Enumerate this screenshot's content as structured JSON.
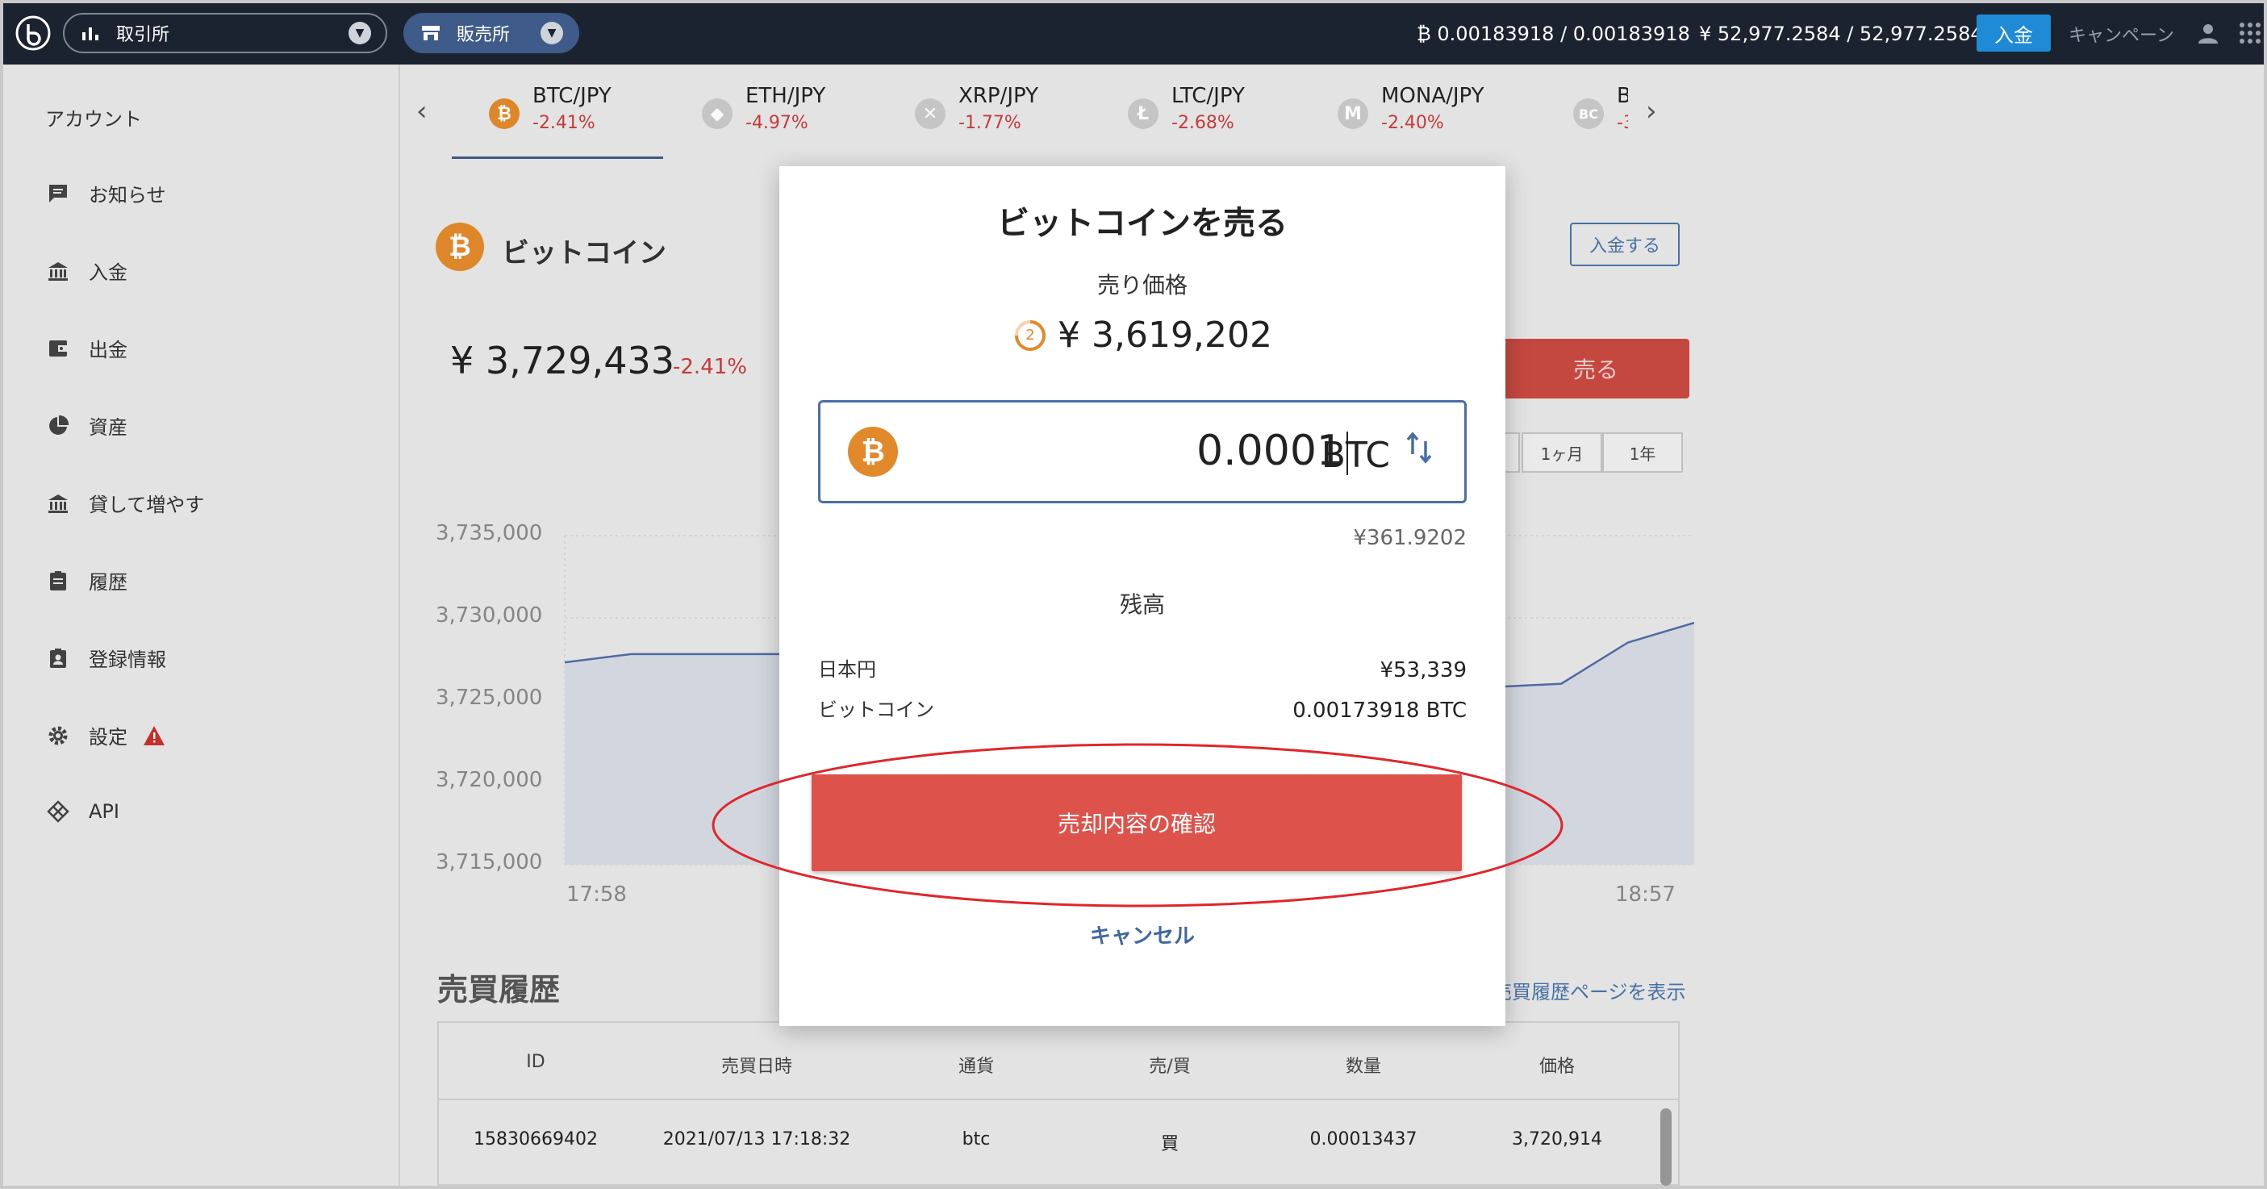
{
  "header": {
    "exchange_select": "取引所",
    "store_select": "販売所",
    "btc_balance": "₿ 0.00183918 / 0.00183918",
    "jpy_balance": "¥ 52,977.2584 / 52,977.2584",
    "deposit_label": "入金",
    "campaign_label": "キャンペーン"
  },
  "sidebar": {
    "title": "アカウント",
    "items": [
      {
        "label": "お知らせ",
        "icon": "message-icon"
      },
      {
        "label": "入金",
        "icon": "bank-icon"
      },
      {
        "label": "出金",
        "icon": "wallet-icon"
      },
      {
        "label": "資産",
        "icon": "pie-chart-icon"
      },
      {
        "label": "貸して増やす",
        "icon": "bank-icon"
      },
      {
        "label": "履歴",
        "icon": "clipboard-icon"
      },
      {
        "label": "登録情報",
        "icon": "id-badge-icon"
      },
      {
        "label": "設定",
        "icon": "gear-icon"
      },
      {
        "label": "API",
        "icon": "api-icon"
      }
    ],
    "warning_icon": "warning-icon"
  },
  "tabs": [
    {
      "name": "BTC/JPY",
      "change": "-2.41%",
      "symbol": "₿"
    },
    {
      "name": "ETH/JPY",
      "change": "-4.97%",
      "symbol": "◆"
    },
    {
      "name": "XRP/JPY",
      "change": "-1.77%",
      "symbol": "✕"
    },
    {
      "name": "LTC/JPY",
      "change": "-2.68%",
      "symbol": "Ł"
    },
    {
      "name": "MONA/JPY",
      "change": "-2.40%",
      "symbol": "M"
    },
    {
      "name": "B",
      "change": "-3",
      "symbol": "BC"
    }
  ],
  "market": {
    "coin_name": "ビットコイン",
    "price": "¥ 3,729,433",
    "change": "-2.41%",
    "deposit_button": "入金する",
    "sell_button": "売る",
    "ranges": [
      "1ヶ月",
      "1年"
    ]
  },
  "chart_data": {
    "type": "line",
    "y_ticks": [
      "3,735,000",
      "3,730,000",
      "3,725,000",
      "3,720,000",
      "3,715,000"
    ],
    "x_ticks": [
      "17:58",
      "18:57"
    ],
    "ylim": [
      3715000,
      3735000
    ],
    "series": [
      {
        "values": [
          3727300,
          3727800,
          3727800,
          3727800,
          3727800,
          3726600,
          3728200,
          3728200,
          3728200,
          3726800,
          3722100,
          3721500,
          3721000,
          3722000,
          3725800,
          3726000,
          3728500,
          3729700
        ]
      }
    ],
    "color": "#4f6ea5",
    "grid": true
  },
  "history": {
    "title": "売買履歴",
    "link": "売買履歴ページを表示",
    "headers": [
      "ID",
      "売買日時",
      "通貨",
      "売/買",
      "数量",
      "価格"
    ],
    "rows": [
      [
        "15830669402",
        "2021/07/13 17:18:32",
        "btc",
        "買",
        "0.00013437",
        "3,720,914"
      ]
    ]
  },
  "modal": {
    "title": "ビットコインを売る",
    "price_label": "売り価格",
    "timer": "2",
    "price": "¥ 3,619,202",
    "amount": "0.0001",
    "unit": "BTC",
    "jpy_equiv": "¥361.9202",
    "balance_title": "残高",
    "balances": [
      {
        "label": "日本円",
        "value": "¥53,339"
      },
      {
        "label": "ビットコイン",
        "value": "0.00173918 BTC"
      }
    ],
    "confirm_button": "売却内容の確認",
    "cancel_button": "キャンセル"
  },
  "colors": {
    "header_bg": "#1b2330",
    "accent_blue": "#3e5b8a",
    "sell_red": "#dd524b",
    "highlight_red": "#e0262a",
    "bitcoin_orange": "#e28a2b"
  }
}
